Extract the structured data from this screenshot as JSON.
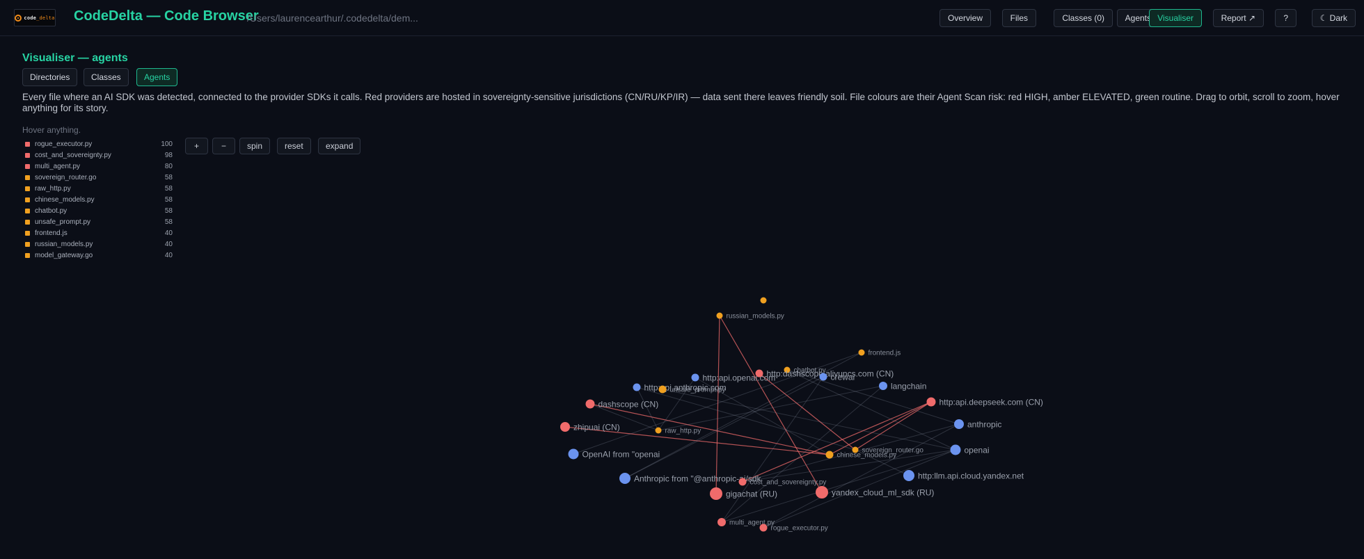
{
  "header": {
    "logo_text_a": "code",
    "logo_text_b": "_delta",
    "title": "CodeDelta — Code Browser",
    "path": "/Users/laurencearthur/.codedelta/dem...",
    "nav": [
      {
        "label": "Overview",
        "active": false
      },
      {
        "label": "Files",
        "active": false
      },
      {
        "label": "Classes (0)",
        "active": false
      },
      {
        "label": "Agents",
        "active": false
      },
      {
        "label": "Visualiser",
        "active": true
      },
      {
        "label": "Report ↗",
        "active": false
      },
      {
        "label": "?",
        "active": false
      },
      {
        "label": "☾ Dark",
        "active": false
      }
    ]
  },
  "visualiser": {
    "title": "Visualiser — agents",
    "tabs": [
      {
        "label": "Directories",
        "active": false
      },
      {
        "label": "Classes",
        "active": false
      },
      {
        "label": "Agents",
        "active": true
      }
    ],
    "description": "Every file where an AI SDK was detected, connected to the provider SDKs it calls. Red providers are hosted in sovereignty-sensitive jurisdictions (CN/RU/KP/IR) — data sent there leaves friendly soil. File colours are their Agent Scan risk: red HIGH, amber ELEVATED, green routine. Drag to orbit, scroll to zoom, hover anything for its story.",
    "hover_hint": "Hover anything.",
    "controls": [
      "+",
      "−",
      "spin",
      "reset",
      "expand"
    ]
  },
  "colors": {
    "high": "#f06b6b",
    "elevated": "#f0a020",
    "provider": "#6b93ef",
    "accent": "#27d3a3"
  },
  "files": [
    {
      "name": "rogue_executor.py",
      "score": 100,
      "risk": "high"
    },
    {
      "name": "cost_and_sovereignty.py",
      "score": 98,
      "risk": "high"
    },
    {
      "name": "multi_agent.py",
      "score": 80,
      "risk": "high"
    },
    {
      "name": "sovereign_router.go",
      "score": 58,
      "risk": "elevated"
    },
    {
      "name": "raw_http.py",
      "score": 58,
      "risk": "elevated"
    },
    {
      "name": "chinese_models.py",
      "score": 58,
      "risk": "elevated"
    },
    {
      "name": "chatbot.py",
      "score": 58,
      "risk": "elevated"
    },
    {
      "name": "unsafe_prompt.py",
      "score": 58,
      "risk": "elevated"
    },
    {
      "name": "frontend.js",
      "score": 40,
      "risk": "elevated"
    },
    {
      "name": "russian_models.py",
      "score": 40,
      "risk": "elevated"
    },
    {
      "name": "model_gateway.go",
      "score": 40,
      "risk": "elevated"
    }
  ],
  "graph_nodes": [
    {
      "id": "unlabeled",
      "label": "",
      "kind": "elevated"
    },
    {
      "id": "russian",
      "label": "russian_models.py",
      "kind": "elevated"
    },
    {
      "id": "frontend",
      "label": "frontend.js",
      "kind": "elevated"
    },
    {
      "id": "chatbot",
      "label": "chatbot.py",
      "kind": "elevated"
    },
    {
      "id": "openai_api",
      "label": "http:api.openai.com",
      "kind": "provider"
    },
    {
      "id": "dashscope_api",
      "label": "http:dashscope.aliyuncs.com (CN)",
      "kind": "high"
    },
    {
      "id": "crewai",
      "label": "crewai",
      "kind": "provider"
    },
    {
      "id": "anthropic_api",
      "label": "http:api.anthropic.com",
      "kind": "provider"
    },
    {
      "id": "unsafe",
      "label": "unsafe_prompt.py",
      "kind": "elevated"
    },
    {
      "id": "langchain",
      "label": "langchain",
      "kind": "provider"
    },
    {
      "id": "dashscope",
      "label": "dashscope (CN)",
      "kind": "high"
    },
    {
      "id": "deepseek",
      "label": "http:api.deepseek.com (CN)",
      "kind": "high"
    },
    {
      "id": "zhipuai",
      "label": "zhipuai (CN)",
      "kind": "high"
    },
    {
      "id": "rawhttp",
      "label": "raw_http.py",
      "kind": "elevated"
    },
    {
      "id": "anthropic",
      "label": "anthropic",
      "kind": "provider"
    },
    {
      "id": "sovrouter",
      "label": "sovereign_router.go",
      "kind": "elevated"
    },
    {
      "id": "openai_from",
      "label": "OpenAI from \"openai",
      "kind": "provider"
    },
    {
      "id": "chinese",
      "label": "chinese_models.py",
      "kind": "elevated"
    },
    {
      "id": "openai",
      "label": "openai",
      "kind": "provider"
    },
    {
      "id": "yandex_api",
      "label": "http:llm.api.cloud.yandex.net",
      "kind": "provider"
    },
    {
      "id": "anthropic_from",
      "label": "Anthropic from \"@anthropic-ai/sdk",
      "kind": "provider"
    },
    {
      "id": "cost",
      "label": "cost_and_sovereignty.py",
      "kind": "high"
    },
    {
      "id": "gigachat",
      "label": "gigachat (RU)",
      "kind": "high"
    },
    {
      "id": "yandex",
      "label": "yandex_cloud_ml_sdk (RU)",
      "kind": "high"
    },
    {
      "id": "multi",
      "label": "multi_agent.py",
      "kind": "high"
    },
    {
      "id": "rogue",
      "label": "rogue_executor.py",
      "kind": "high"
    }
  ],
  "graph_edges": [
    {
      "from": "russian",
      "to": "gigachat",
      "sovereign": true
    },
    {
      "from": "russian",
      "to": "yandex",
      "sovereign": true
    },
    {
      "from": "cost",
      "to": "deepseek",
      "sovereign": true
    },
    {
      "from": "chinese",
      "to": "deepseek",
      "sovereign": true
    },
    {
      "from": "chinese",
      "to": "dashscope",
      "sovereign": true
    },
    {
      "from": "chinese",
      "to": "zhipuai",
      "sovereign": true
    },
    {
      "from": "sovrouter",
      "to": "deepseek",
      "sovereign": true
    },
    {
      "from": "sovrouter",
      "to": "dashscope_api",
      "sovereign": true
    },
    {
      "from": "rawhttp",
      "to": "dashscope",
      "sovereign": false
    },
    {
      "from": "rawhttp",
      "to": "anthropic_api",
      "sovereign": false
    },
    {
      "from": "rawhttp",
      "to": "openai_api",
      "sovereign": false
    },
    {
      "from": "frontend",
      "to": "openai_from",
      "sovereign": false
    },
    {
      "from": "frontend",
      "to": "anthropic_from",
      "sovereign": false
    },
    {
      "from": "chatbot",
      "to": "openai",
      "sovereign": false
    },
    {
      "from": "chatbot",
      "to": "anthropic",
      "sovereign": false
    },
    {
      "from": "unsafe",
      "to": "openai",
      "sovereign": false
    },
    {
      "from": "crewai",
      "to": "multi",
      "sovereign": false
    },
    {
      "from": "langchain",
      "to": "multi",
      "sovereign": false
    },
    {
      "from": "openai",
      "to": "multi",
      "sovereign": false
    },
    {
      "from": "anthropic",
      "to": "rogue",
      "sovereign": false
    },
    {
      "from": "openai",
      "to": "rogue",
      "sovereign": false
    },
    {
      "from": "yandex_api",
      "to": "sovrouter",
      "sovereign": false
    },
    {
      "from": "cost",
      "to": "openai",
      "sovereign": false
    },
    {
      "from": "cost",
      "to": "anthropic",
      "sovereign": false
    },
    {
      "from": "openai_api",
      "to": "chinese",
      "sovereign": false
    },
    {
      "from": "langchain",
      "to": "rawhttp",
      "sovereign": false
    },
    {
      "from": "crewai",
      "to": "anthropic_from",
      "sovereign": false
    },
    {
      "from": "anthropic_api",
      "to": "sovrouter",
      "sovereign": false
    }
  ]
}
